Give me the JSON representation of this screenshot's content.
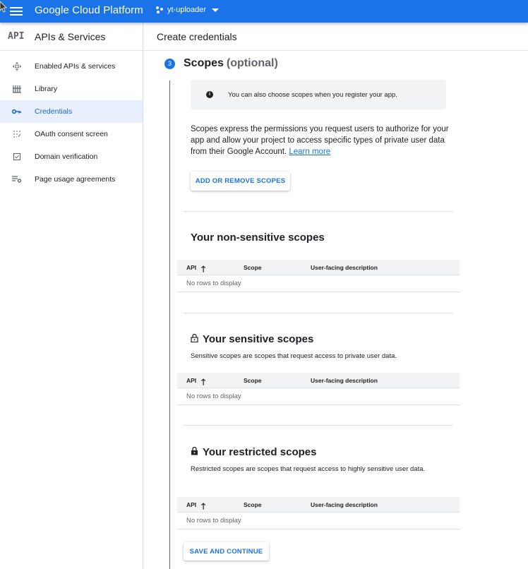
{
  "topbar": {
    "brand": "Google Cloud Platform",
    "project": "yt-uploader",
    "color": "#1a73e8"
  },
  "sidebar": {
    "logo": "API",
    "title": "APIs & Services",
    "items": [
      {
        "label": "Enabled APIs & services",
        "icon": "move-icon",
        "active": false
      },
      {
        "label": "Library",
        "icon": "library-icon",
        "active": false
      },
      {
        "label": "Credentials",
        "icon": "key-icon",
        "active": true
      },
      {
        "label": "OAuth consent screen",
        "icon": "consent-icon",
        "active": false
      },
      {
        "label": "Domain verification",
        "icon": "checkbox-icon",
        "active": false
      },
      {
        "label": "Page usage agreements",
        "icon": "settings-list-icon",
        "active": false
      }
    ]
  },
  "main": {
    "header": "Create credentials",
    "step": {
      "number": "3",
      "title": "Scopes",
      "optional": "(optional)"
    },
    "info": "You can also choose scopes when you register your app.",
    "description": "Scopes express the permissions you request users to authorize for your app and allow your project to access specific types of private user data from their Google Account.",
    "learn_more": "Learn more",
    "add_scopes_button": "ADD OR REMOVE SCOPES",
    "sections": [
      {
        "title": "Your non-sensitive scopes",
        "subtitle": "",
        "columns": [
          "API",
          "Scope",
          "User-facing description"
        ],
        "empty": "No rows to display"
      },
      {
        "title": "Your sensitive scopes",
        "subtitle": "Sensitive scopes are scopes that request access to private user data.",
        "columns": [
          "API",
          "Scope",
          "User-facing description"
        ],
        "empty": "No rows to display"
      },
      {
        "title": "Your restricted scopes",
        "subtitle": "Restricted scopes are scopes that request access to highly sensitive user data.",
        "columns": [
          "API",
          "Scope",
          "User-facing description"
        ],
        "empty": "No rows to display"
      }
    ],
    "save_button": "SAVE AND CONTINUE"
  }
}
